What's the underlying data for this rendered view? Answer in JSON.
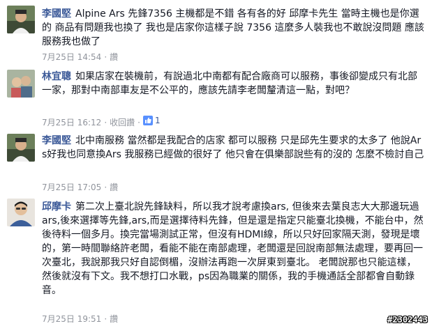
{
  "comments": [
    {
      "author": "李國堅",
      "text": "Alpine Ars 先鋒7356 主機都是不錯 各有各的好 邱摩卡先生 當時主機也是你選的 商品有問題我也換了 我也是店家你這樣子說 7356 這麼多人裝我也不敢說沒問題 應該服務我也做了",
      "time": "7月25日 14:54",
      "like": "讚"
    },
    {
      "author": "林宜聰",
      "text": "如果店家在裝機前，有說過北中南都有配合廠商可以服務，事後卻變成只有北部一家，那對中南部車友是不公平的，應該先請李老闆釐清這一點，對吧？",
      "time": "7月25日 16:12",
      "action": "收回讚",
      "like_count": "1"
    },
    {
      "author": "李國堅",
      "text": "北中南服務 當然都是我配合的店家 都可以服務 只是邱先生要求的太多了 他說Ars好我也同意換Ars 我服務已經做的很好了 他只會在俱樂部說些有的沒的 怎麼不檢討自己",
      "time": "7月25日 17:05",
      "like": "讚"
    },
    {
      "author": "邱摩卡",
      "text": "第二次上臺北說先鋒缺料，所以我才說考慮換ars, 但後來去葉良志大大那邊玩過ars,後來選擇等先鋒,ars,而是選擇待料先鋒，但是還是指定只能臺北換機，不能台中，然後待料一個多月。換完當場測試正常，但沒有HDMI線，所以只好回家隔天測，發現是壞的，第一時間聯絡許老闆，看能不能在南部處理，老闆還是回說南部無法處理，要再回一次臺北，我說那我只好自認倒楣，沒辦法再跑一次屏東到臺北。 老闆說那也只能這樣，然後就沒有下文。我不想打口水戰，ps因為職業的關係，我的手機通話全部都會自動錄音。",
      "time": "7月25日 19:51",
      "like": "讚"
    }
  ],
  "watermark": "#2302443",
  "colors": {
    "author": "#3b5998",
    "meta": "#90949c",
    "text": "#141823"
  }
}
